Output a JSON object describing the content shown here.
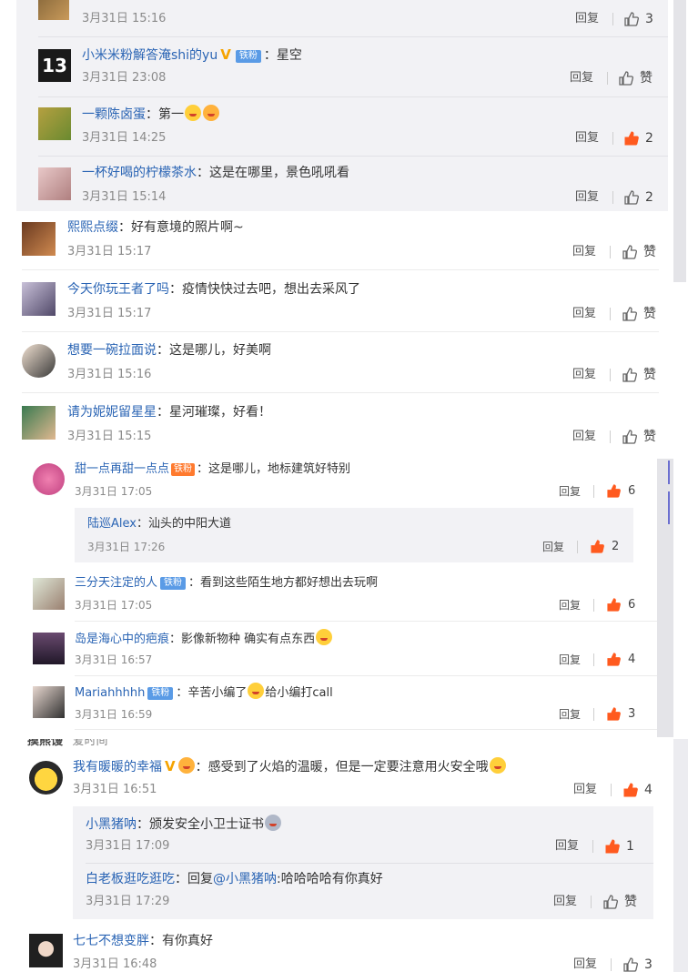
{
  "labels": {
    "reply": "回复",
    "like_zero": "赞"
  },
  "section1": {
    "top_partial": {
      "time": "3月31日 15:16",
      "likes": "3"
    },
    "comments": [
      {
        "name": "小米米粉解答淹shi的yu",
        "badge": "铁粉",
        "text": "星空",
        "time": "3月31日 23:08",
        "likes": "赞"
      },
      {
        "name": "一颗陈卤蛋",
        "text": "第一",
        "time": "3月31日 14:25",
        "likes": "2"
      },
      {
        "name": "一杯好喝的柠檬茶水",
        "text": "这是在哪里，景色吼吼看",
        "time": "3月31日 15:14",
        "likes": "2"
      }
    ]
  },
  "section2": {
    "comments": [
      {
        "name": "熙熙点缀",
        "text": "好有意境的照片啊~",
        "time": "3月31日 15:17",
        "likes": "赞"
      },
      {
        "name": "今天你玩王者了吗",
        "text": "疫情快快过去吧，想出去采风了",
        "time": "3月31日 15:17",
        "likes": "赞"
      },
      {
        "name": "想要一碗拉面说",
        "text": "这是哪儿，好美啊",
        "time": "3月31日 15:16",
        "likes": "赞"
      },
      {
        "name": "请为妮妮留星星",
        "text": "星河璀璨，好看！",
        "time": "3月31日 15:15",
        "likes": "赞"
      }
    ]
  },
  "section3": {
    "comments": [
      {
        "name": "甜一点再甜一点点",
        "badge": "铁粉",
        "text": "这是哪儿，地标建筑好特别",
        "time": "3月31日 17:05",
        "likes": "6"
      },
      {
        "name": "陆巡Alex",
        "text": "汕头的中阳大道",
        "time": "3月31日 17:26",
        "likes": "2"
      },
      {
        "name": "三分天注定的人",
        "badge": "铁粉",
        "text": "看到这些陌生地方都好想出去玩啊",
        "time": "3月31日 17:05",
        "likes": "6"
      },
      {
        "name": "岛是海心中的疤痕",
        "text": "影像新物种 确实有点东西",
        "time": "3月31日 16:57",
        "likes": "4"
      },
      {
        "name": "Mariahhhhh",
        "badge": "铁粉",
        "text": "辛苦小编了",
        "text2": "给小编打call",
        "time": "3月31日 16:59",
        "likes": "3"
      }
    ]
  },
  "section4": {
    "cut_name": "摸熊馒",
    "cut_text": "爱时间",
    "comments": [
      {
        "name": "我有暖暖的幸福",
        "text": "感受到了火焰的温暖，但是一定要注意用火安全哦",
        "time": "3月31日 16:51",
        "likes": "4"
      },
      {
        "name": "小黑猪呐",
        "text": "颁发安全小卫士证书",
        "time": "3月31日 17:09",
        "likes": "1"
      },
      {
        "name": "白老板逛吃逛吃",
        "text_prefix": "回复",
        "mention": "@小黑猪呐",
        "text": ":哈哈哈哈有你真好",
        "time": "3月31日 17:29",
        "likes": "赞"
      },
      {
        "name": "七七不想变胖",
        "text": "有你真好",
        "time": "3月31日 16:48",
        "likes": "3"
      }
    ]
  },
  "colors": {
    "name": "#2a64b4",
    "liked": "#ff5a1f",
    "link": "#2a64b4"
  }
}
